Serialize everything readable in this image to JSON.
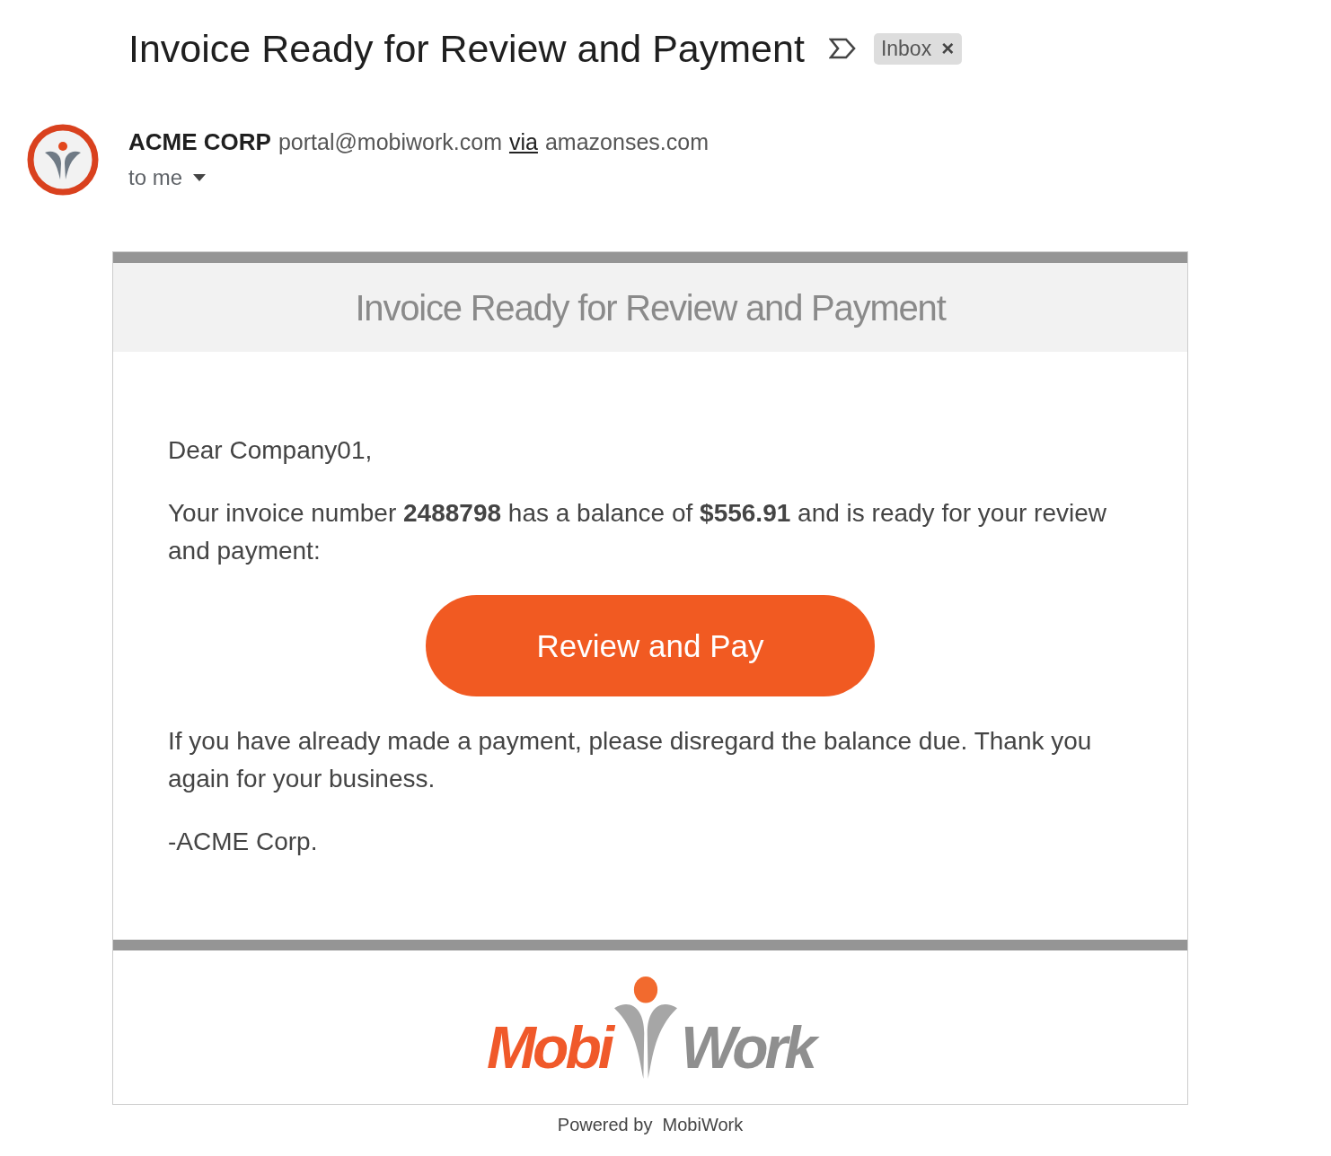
{
  "subject": {
    "title": "Invoice Ready for Review and Payment",
    "label": "Inbox",
    "remove": "×"
  },
  "sender": {
    "name": "ACME CORP",
    "email": "portal@mobiwork.com",
    "via": "via",
    "domain": "amazonses.com",
    "recipient": "to me"
  },
  "email_body": {
    "heading": "Invoice Ready for Review and Payment",
    "greeting": "Dear Company01,",
    "intro": "Your invoice number **2488798** has a balance of **$556.91** and is ready for your review and payment:",
    "button": "Review and Pay",
    "note": "If you have already made a payment, please disregard the balance due. Thank you again for your business.",
    "signature": "-ACME Corp.",
    "logo": {
      "left": "Mobi",
      "right": "Work"
    }
  },
  "footer": "Powered by  MobiWork"
}
